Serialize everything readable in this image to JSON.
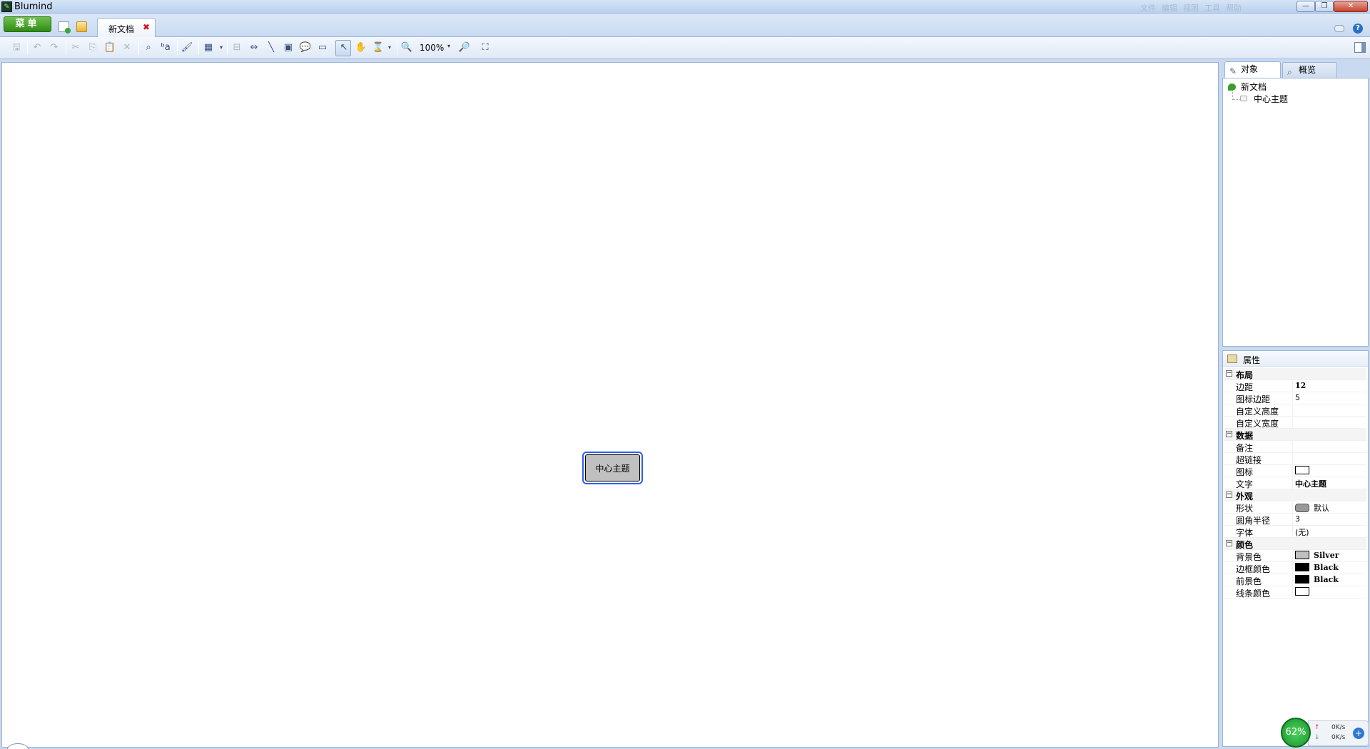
{
  "window": {
    "app_title": "Blumind",
    "faded_menu": [
      "文件",
      "编辑",
      "视图",
      "工具",
      "帮助"
    ],
    "min_glyph": "—",
    "max_glyph": "❐",
    "close_glyph": "✕"
  },
  "tabrow": {
    "menu_label": "菜单",
    "doc_tab_label": "新文档",
    "tab_close_glyph": "✖",
    "help_glyph": "?"
  },
  "toolbar": {
    "zoom_level": "100%",
    "dropdown_glyph": "▾",
    "icons": {
      "save": "🖫",
      "undo": "↶",
      "redo": "↷",
      "cut": "✂",
      "copy": "⎘",
      "paste": "📋",
      "delete": "✕",
      "find": "⌕",
      "replace": "ᵇa",
      "format_painter": "🖌",
      "layout": "▦",
      "insert_topic": "⊟",
      "insert_link": "⇔",
      "line": "╲",
      "note": "▣",
      "callout": "💬",
      "label": "▭",
      "pointer": "↖",
      "hand": "✋",
      "timer": "⌛",
      "zoom_out": "🔍",
      "zoom_in": "🔎",
      "fit": "⛶"
    }
  },
  "canvas": {
    "central_topic": "中心主题"
  },
  "objects_panel": {
    "tab_objects": "对象",
    "tab_overview": "概览",
    "tree_root": "新文档",
    "tree_child": "中心主题"
  },
  "properties": {
    "title": "属性",
    "collapse_glyph": "−",
    "categories": {
      "layout": "布局",
      "data": "数据",
      "appearance": "外观",
      "color": "颜色"
    },
    "rows": {
      "padding": {
        "name": "边距",
        "value": "12"
      },
      "icon_padding": {
        "name": "图标边距",
        "value": "5"
      },
      "custom_height": {
        "name": "自定义高度",
        "value": ""
      },
      "custom_width": {
        "name": "自定义宽度",
        "value": ""
      },
      "remark": {
        "name": "备注",
        "value": ""
      },
      "hyperlink": {
        "name": "超链接",
        "value": ""
      },
      "icon": {
        "name": "图标",
        "value": ""
      },
      "text": {
        "name": "文字",
        "value": "中心主题"
      },
      "shape": {
        "name": "形状",
        "value": "默认"
      },
      "corner_radius": {
        "name": "圆角半径",
        "value": "3"
      },
      "font": {
        "name": "字体",
        "value": "(无)"
      },
      "back_color": {
        "name": "背景色",
        "value": "Silver",
        "hex": "#C0C0C0"
      },
      "border_color": {
        "name": "边框颜色",
        "value": "Black",
        "hex": "#000000"
      },
      "fore_color": {
        "name": "前景色",
        "value": "Black",
        "hex": "#000000"
      },
      "line_color": {
        "name": "线条颜色",
        "value": "",
        "hex": "#FFFFFF"
      }
    }
  },
  "monitor": {
    "cpu": "62%",
    "up_arrow": "↑",
    "down_arrow": "↓",
    "up_speed": "0K/s",
    "down_speed": "0K/s",
    "boost_glyph": "+"
  },
  "colors": {
    "accent_green": "#2F8A16",
    "selection_blue": "#2E5FF3",
    "topic_fill": "#C0C0C0",
    "close_red": "#D0161C"
  }
}
